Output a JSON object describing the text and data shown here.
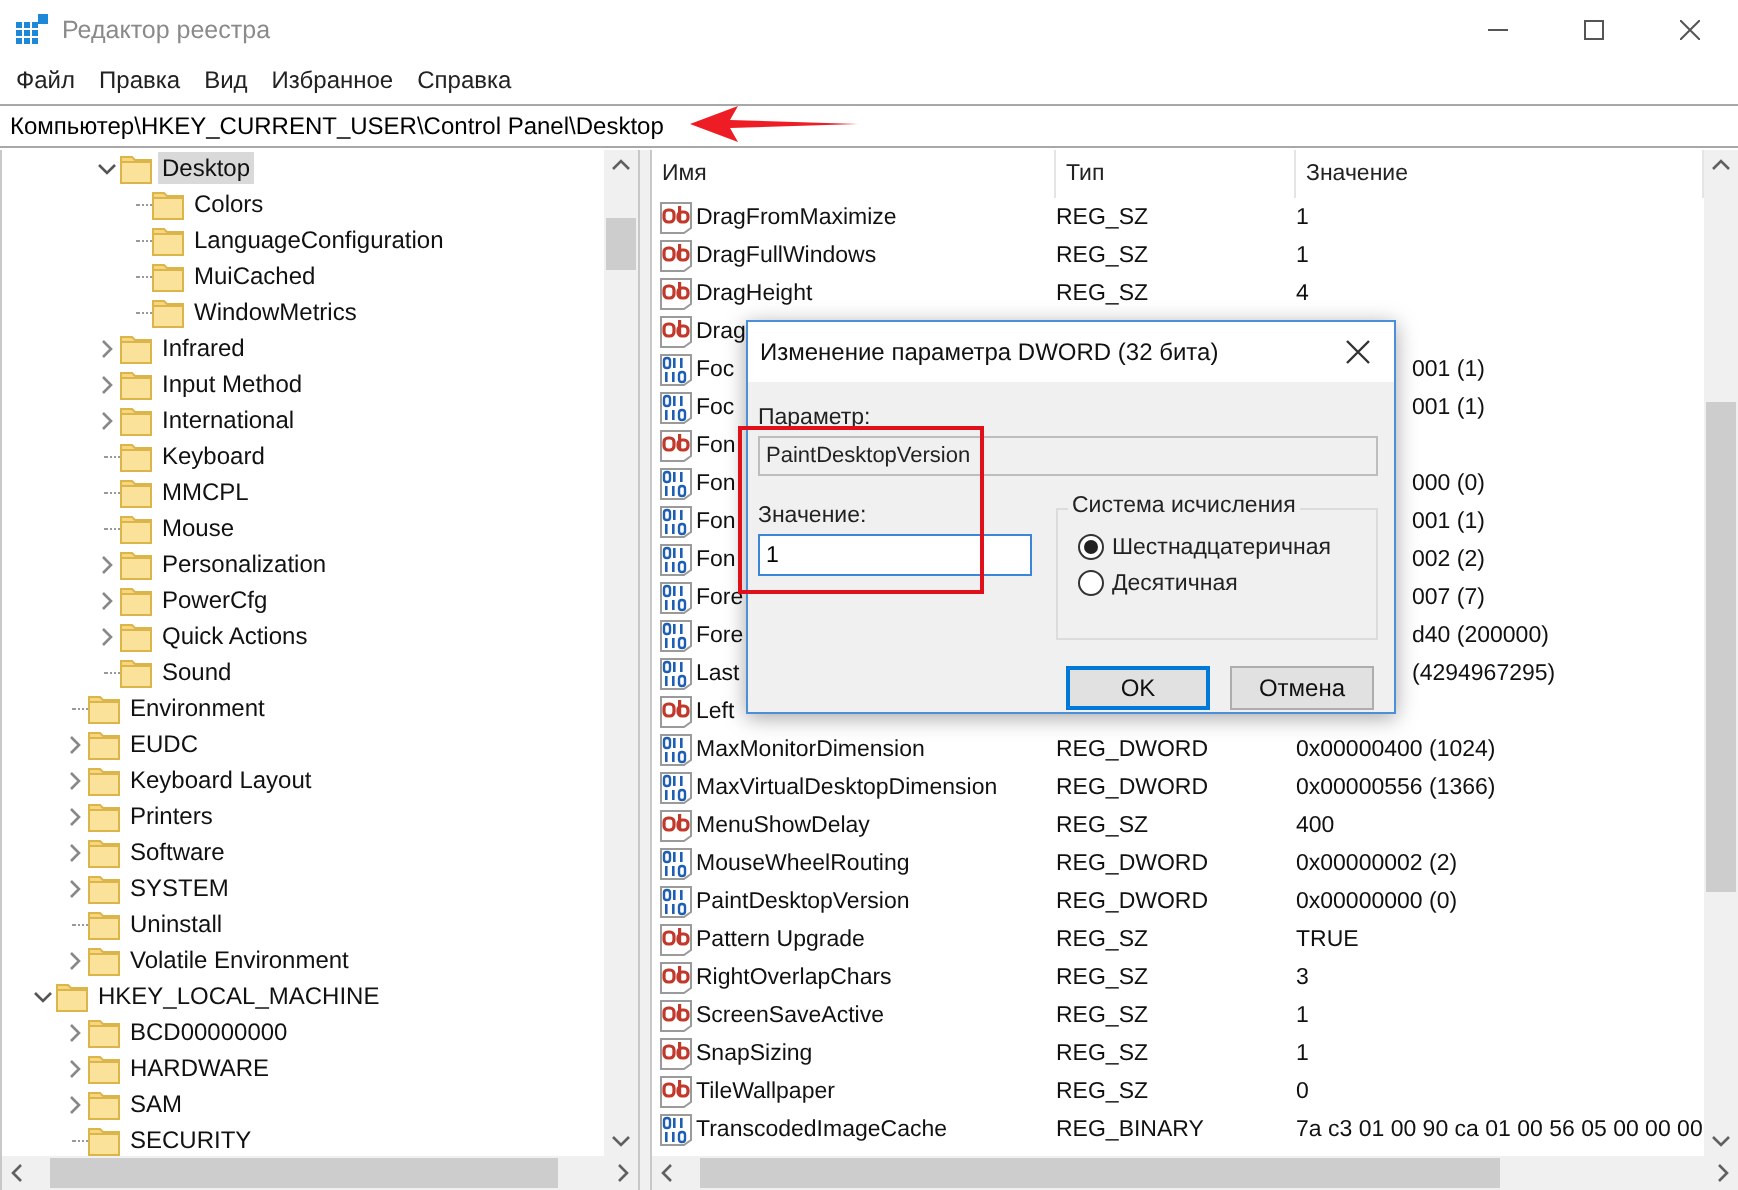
{
  "window": {
    "title": "Редактор реестра"
  },
  "menu": [
    "Файл",
    "Правка",
    "Вид",
    "Избранное",
    "Справка"
  ],
  "address": "Компьютер\\HKEY_CURRENT_USER\\Control Panel\\Desktop",
  "tree": [
    {
      "children": [
        {
          "children": [
            {
              "label": "Desktop",
              "expandable": true,
              "expanded": true,
              "selected": true,
              "children": [
                {
                  "label": "Colors",
                  "expandable": false,
                  "expanded": false,
                  "selected": false
                },
                {
                  "label": "LanguageConfiguration",
                  "expandable": false,
                  "expanded": false,
                  "selected": false
                },
                {
                  "label": "MuiCached",
                  "expandable": false,
                  "expanded": false,
                  "selected": false
                },
                {
                  "label": "WindowMetrics",
                  "expandable": false,
                  "expanded": false,
                  "selected": false
                }
              ]
            },
            {
              "label": "Infrared",
              "expandable": true,
              "expanded": false,
              "selected": false
            },
            {
              "label": "Input Method",
              "expandable": true,
              "expanded": false,
              "selected": false
            },
            {
              "label": "International",
              "expandable": true,
              "expanded": false,
              "selected": false
            },
            {
              "label": "Keyboard",
              "expandable": false,
              "expanded": false,
              "selected": false
            },
            {
              "label": "MMCPL",
              "expandable": false,
              "expanded": false,
              "selected": false
            },
            {
              "label": "Mouse",
              "expandable": false,
              "expanded": false,
              "selected": false
            },
            {
              "label": "Personalization",
              "expandable": true,
              "expanded": false,
              "selected": false
            },
            {
              "label": "PowerCfg",
              "expandable": true,
              "expanded": false,
              "selected": false
            },
            {
              "label": "Quick Actions",
              "expandable": true,
              "expanded": false,
              "selected": false
            },
            {
              "label": "Sound",
              "expandable": false,
              "expanded": false,
              "selected": false
            }
          ]
        },
        {
          "label": "Environment",
          "expandable": false,
          "expanded": false,
          "selected": false
        },
        {
          "label": "EUDC",
          "expandable": true,
          "expanded": false,
          "selected": false
        },
        {
          "label": "Keyboard Layout",
          "expandable": true,
          "expanded": false,
          "selected": false
        },
        {
          "label": "Printers",
          "expandable": true,
          "expanded": false,
          "selected": false
        },
        {
          "label": "Software",
          "expandable": true,
          "expanded": false,
          "selected": false
        },
        {
          "label": "SYSTEM",
          "expandable": true,
          "expanded": false,
          "selected": false
        },
        {
          "label": "Uninstall",
          "expandable": false,
          "expanded": false,
          "selected": false
        },
        {
          "label": "Volatile Environment",
          "expandable": true,
          "expanded": false,
          "selected": false
        }
      ]
    },
    {
      "label": "HKEY_LOCAL_MACHINE",
      "expandable": true,
      "expanded": true,
      "selected": false,
      "children": [
        {
          "label": "BCD00000000",
          "expandable": true,
          "expanded": false,
          "selected": false
        },
        {
          "label": "HARDWARE",
          "expandable": true,
          "expanded": false,
          "selected": false
        },
        {
          "label": "SAM",
          "expandable": true,
          "expanded": false,
          "selected": false
        },
        {
          "label": "SECURITY",
          "expandable": false,
          "expanded": false,
          "selected": false
        }
      ]
    }
  ],
  "list": {
    "columns": [
      "Имя",
      "Тип",
      "Значение"
    ],
    "rows": [
      {
        "kind": "string",
        "name": "DragFromMaximize",
        "type": "REG_SZ",
        "value": "1",
        "covered": false
      },
      {
        "kind": "string",
        "name": "DragFullWindows",
        "type": "REG_SZ",
        "value": "1",
        "covered": false
      },
      {
        "kind": "string",
        "name": "DragHeight",
        "type": "REG_SZ",
        "value": "4",
        "covered": false
      },
      {
        "kind": "string",
        "name": "Drag"
      },
      {
        "kind": "number",
        "name": "Foc",
        "value": "001 (1)",
        "covered": true
      },
      {
        "kind": "number",
        "name": "Foc",
        "value": "001 (1)",
        "covered": true
      },
      {
        "kind": "string",
        "name": "Fon"
      },
      {
        "kind": "number",
        "name": "Fon",
        "value": "000 (0)",
        "covered": true
      },
      {
        "kind": "number",
        "name": "Fon",
        "value": "001 (1)",
        "covered": true
      },
      {
        "kind": "number",
        "name": "Fon",
        "value": "002 (2)",
        "covered": true
      },
      {
        "kind": "number",
        "name": "Fore",
        "value": "007 (7)",
        "covered": true
      },
      {
        "kind": "number",
        "name": "Fore",
        "value": "d40 (200000)",
        "covered": true
      },
      {
        "kind": "number",
        "name": "Last",
        "value": "(4294967295)",
        "covered": true
      },
      {
        "kind": "string",
        "name": "Left"
      },
      {
        "kind": "number",
        "name": "MaxMonitorDimension",
        "type": "REG_DWORD",
        "value": "0x00000400 (1024)",
        "covered": false
      },
      {
        "kind": "number",
        "name": "MaxVirtualDesktopDimension",
        "type": "REG_DWORD",
        "value": "0x00000556 (1366)",
        "covered": false
      },
      {
        "kind": "string",
        "name": "MenuShowDelay",
        "type": "REG_SZ",
        "value": "400",
        "covered": false
      },
      {
        "kind": "number",
        "name": "MouseWheelRouting",
        "type": "REG_DWORD",
        "value": "0x00000002 (2)",
        "covered": false
      },
      {
        "kind": "number",
        "name": "PaintDesktopVersion",
        "type": "REG_DWORD",
        "value": "0x00000000 (0)",
        "covered": false
      },
      {
        "kind": "string",
        "name": "Pattern Upgrade",
        "type": "REG_SZ",
        "value": "TRUE",
        "covered": false
      },
      {
        "kind": "string",
        "name": "RightOverlapChars",
        "type": "REG_SZ",
        "value": "3",
        "covered": false
      },
      {
        "kind": "string",
        "name": "ScreenSaveActive",
        "type": "REG_SZ",
        "value": "1",
        "covered": false
      },
      {
        "kind": "string",
        "name": "SnapSizing",
        "type": "REG_SZ",
        "value": "1",
        "covered": false
      },
      {
        "kind": "string",
        "name": "TileWallpaper",
        "type": "REG_SZ",
        "value": "0",
        "covered": false
      },
      {
        "kind": "number",
        "name": "TranscodedImageCache",
        "type": "REG_BINARY",
        "value": "7a c3 01 00 90 ca 01 00 56 05 00 00 00",
        "covered": false
      }
    ]
  },
  "dialog": {
    "title": "Изменение параметра DWORD (32 бита)",
    "name_label": "Параметр:",
    "name_value": "PaintDesktopVersion",
    "value_label": "Значение:",
    "value": "1",
    "group_title": "Система исчисления",
    "radios": [
      {
        "label": "Шестнадцатеричная",
        "selected": true
      },
      {
        "label": "Десятичная",
        "selected": false
      }
    ],
    "buttons": [
      {
        "label": "OK",
        "default": true
      },
      {
        "label": "Отмена",
        "default": false
      }
    ]
  }
}
